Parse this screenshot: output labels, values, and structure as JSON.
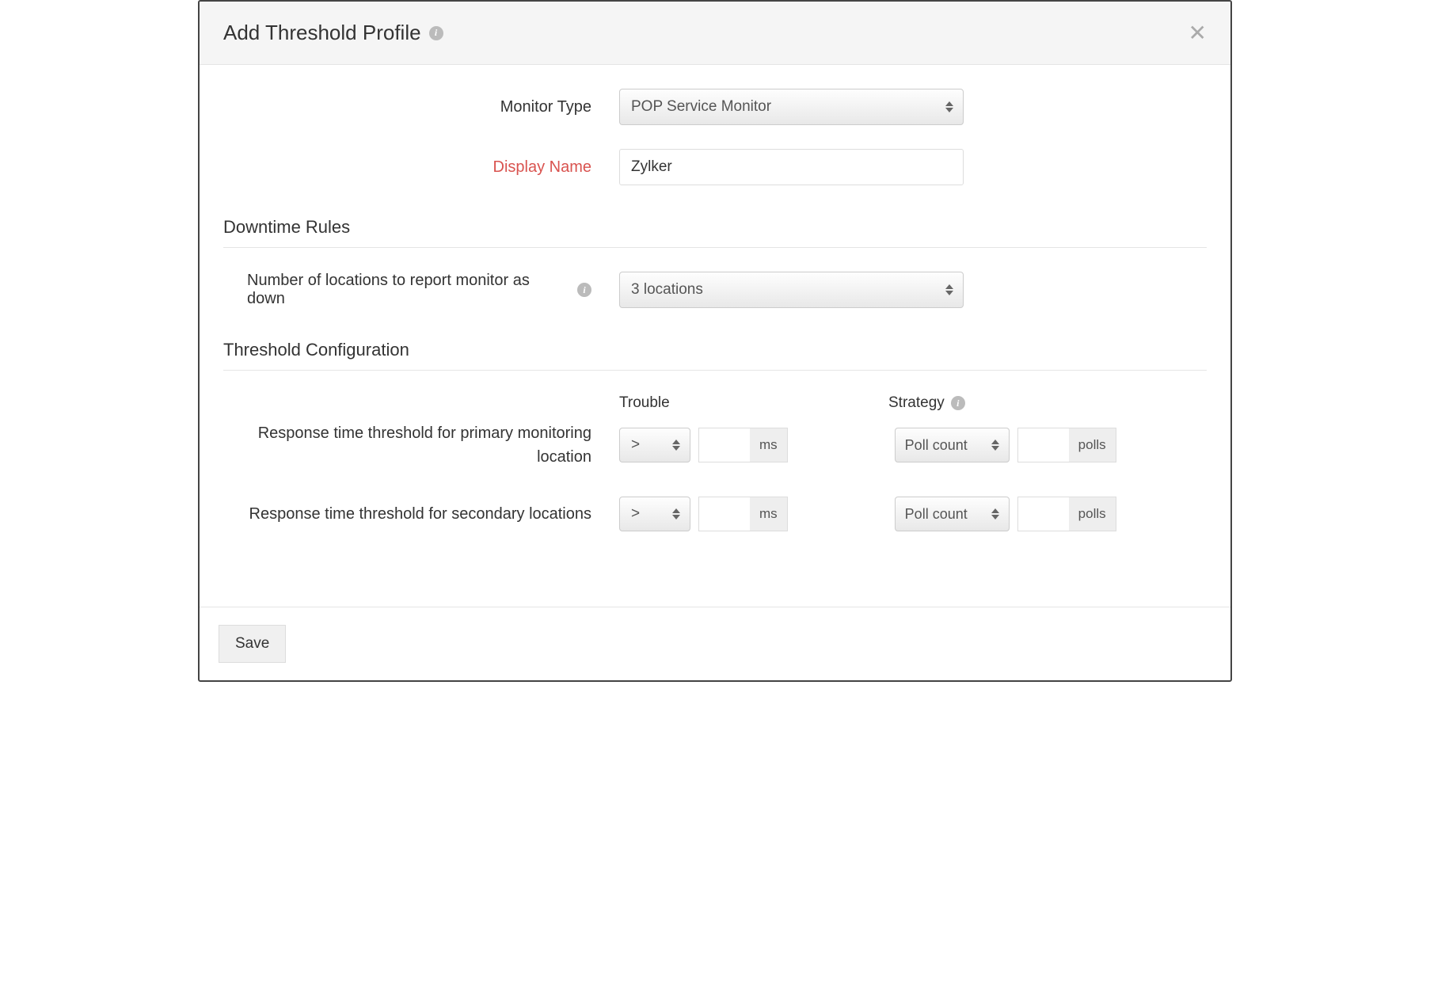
{
  "header": {
    "title": "Add Threshold Profile"
  },
  "form": {
    "monitor_type_label": "Monitor Type",
    "monitor_type_value": "POP Service Monitor",
    "display_name_label": "Display Name",
    "display_name_value": "Zylker"
  },
  "sections": {
    "downtime_title": "Downtime Rules",
    "threshold_title": "Threshold Configuration"
  },
  "downtime": {
    "locations_label": "Number of locations to report monitor as down",
    "locations_value": "3 locations"
  },
  "threshold": {
    "col_trouble": "Trouble",
    "col_strategy": "Strategy",
    "primary_label": "Response time threshold for primary monitoring location",
    "secondary_label": "Response time threshold for secondary locations",
    "operator": ">",
    "unit_ms": "ms",
    "strategy_value": "Poll count",
    "unit_polls": "polls",
    "primary_ms_value": "",
    "primary_polls_value": "",
    "secondary_ms_value": "",
    "secondary_polls_value": ""
  },
  "footer": {
    "save_label": "Save"
  }
}
